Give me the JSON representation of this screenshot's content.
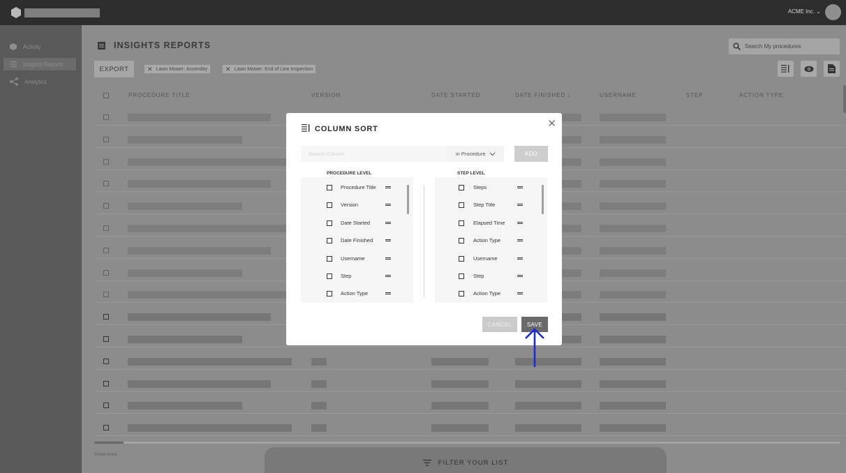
{
  "header": {
    "company": "ACME Inc. ⌄"
  },
  "sidebar": {
    "items": [
      {
        "label": "Activity",
        "icon": "cube-icon"
      },
      {
        "label": "Insights Reports",
        "icon": "list-icon"
      },
      {
        "label": "Analytics",
        "icon": "share-icon"
      }
    ]
  },
  "page": {
    "title": "INSIGHTS REPORTS",
    "search_placeholder": "Search My procedures",
    "export_label": "EXPORT",
    "filters": [
      "Lawn Mower: Assembly",
      "Lawn Mower: End of Line Inspection"
    ],
    "columns": [
      "PROCEDURE TITLE",
      "VERSION",
      "DATE STARTED",
      "DATE FINISHED",
      "USERNAME",
      "STEP",
      "ACTION TYPE"
    ],
    "sort_indicator": "↓",
    "show_more": "Show more",
    "filter_label": "FILTER YOUR LIST"
  },
  "modal": {
    "title": "COLUMN SORT",
    "search_placeholder": "Search Column",
    "scope_select": "in Procedure",
    "add_label": "ADD",
    "procedure_level_title": "PROCEDURE LEVEL",
    "procedure_items": [
      "Procedure Title",
      "Version",
      "Date Started",
      "Date Finished",
      "Username",
      "Step",
      "Action Type"
    ],
    "step_level_title": "STEP LEVEL",
    "step_items": [
      "Steps",
      "Step Title",
      "Elapsed Time",
      "Action Type",
      "Username",
      "Step",
      "Action Type"
    ],
    "cancel_label": "CANCEL",
    "save_label": "SAVE"
  },
  "colors": {
    "accent_arrow": "#1a2ad6"
  }
}
